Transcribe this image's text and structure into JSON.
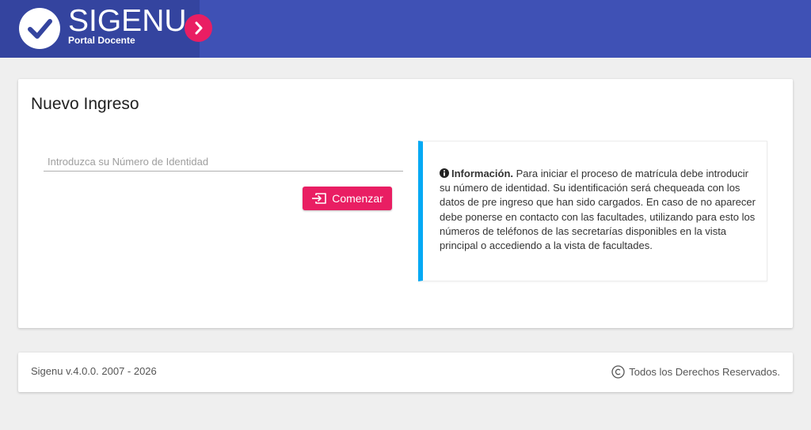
{
  "header": {
    "brand_title": "SIGENU",
    "brand_subtitle": "Portal Docente",
    "logo_icon": "check-circle-icon",
    "toggle_icon": "chevron-right-icon",
    "colors": {
      "bar": "#3f51b5",
      "brand_panel": "#34449f",
      "accent": "#e91e63"
    }
  },
  "main": {
    "title": "Nuevo Ingreso",
    "id_input": {
      "placeholder": "Introduzca su Número de Identidad",
      "value": ""
    },
    "start_button": {
      "label": "Comenzar",
      "icon": "login-icon"
    },
    "info": {
      "icon": "info-circle-icon",
      "heading": "Información.",
      "text": " Para iniciar el proceso de matrícula debe introducir su número de identidad. Su identificación será chequeada con los datos de pre ingreso que han sido cargados. En caso de no aparecer debe ponerse en contacto con las facultades, utilizando para esto los números de teléfonos de las secretarías disponibles en la vista principal o accediendo a la vista de facultades.",
      "accent_color": "#03a9f4"
    }
  },
  "footer": {
    "version": "Sigenu v.4.0.0. 2007 - 2026",
    "rights": "Todos los Derechos Reservados.",
    "rights_icon": "copyright-icon"
  }
}
